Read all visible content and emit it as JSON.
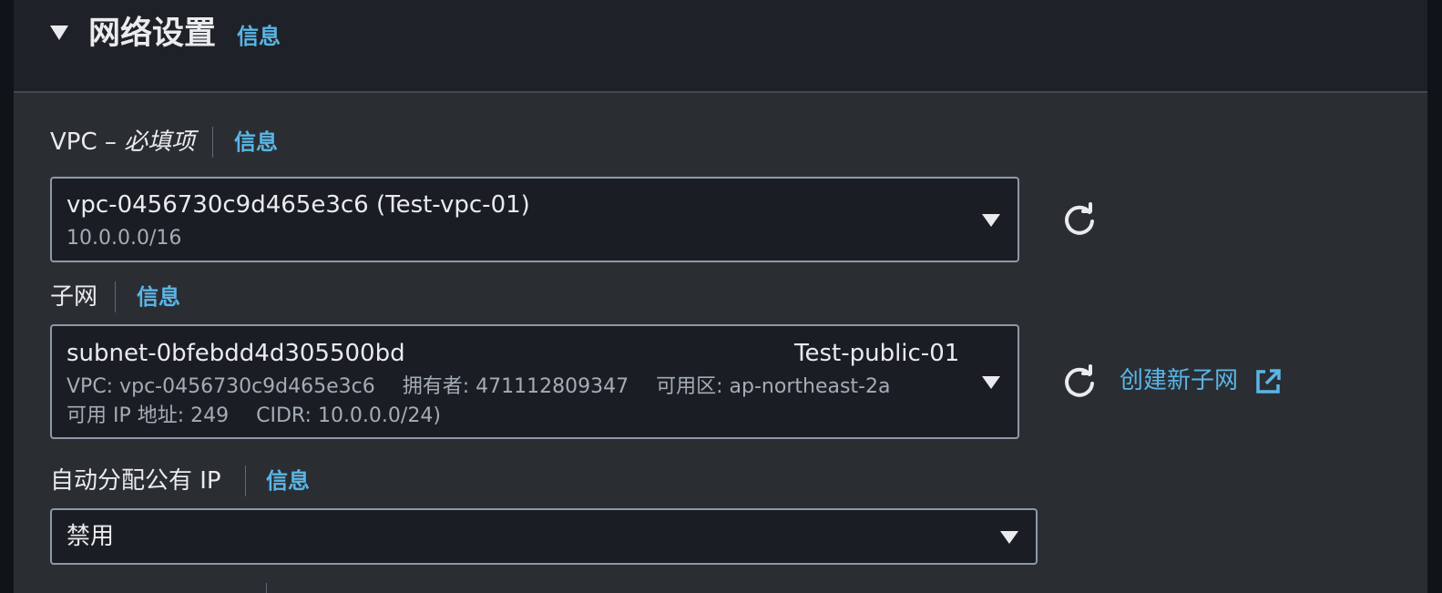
{
  "section": {
    "title": "网络设置",
    "info": "信息"
  },
  "vpc": {
    "label": "VPC",
    "dash": " – ",
    "required": "必填项",
    "info": "信息",
    "selected_main": "vpc-0456730c9d465e3c6 (Test-vpc-01)",
    "selected_sub": "10.0.0.0/16"
  },
  "subnet": {
    "label": "子网",
    "info": "信息",
    "selected_main": "subnet-0bfebdd4d305500bd",
    "selected_name": "Test-public-01",
    "detail_vpc": "VPC: vpc-0456730c9d465e3c6",
    "detail_owner": "拥有者: 471112809347",
    "detail_az": "可用区: ap-northeast-2a",
    "detail_ip": "可用 IP 地址: 249",
    "detail_cidr": "CIDR: 10.0.0.0/24)",
    "create_link": "创建新子网"
  },
  "public_ip": {
    "label": "自动分配公有 IP",
    "info": "信息",
    "selected": "禁用"
  },
  "icons": {
    "toggle": "caret-down-icon",
    "refresh": "refresh-icon",
    "external": "external-link-icon",
    "dropdown": "chevron-down-icon"
  },
  "colors": {
    "panel_bg": "#2a2e33",
    "header_bg": "#1e2228",
    "link": "#5bb5e6",
    "text": "#e9ebed",
    "subtext": "#a4acb6",
    "input_bg": "#1a1e24",
    "input_border": "#8d99a8"
  }
}
